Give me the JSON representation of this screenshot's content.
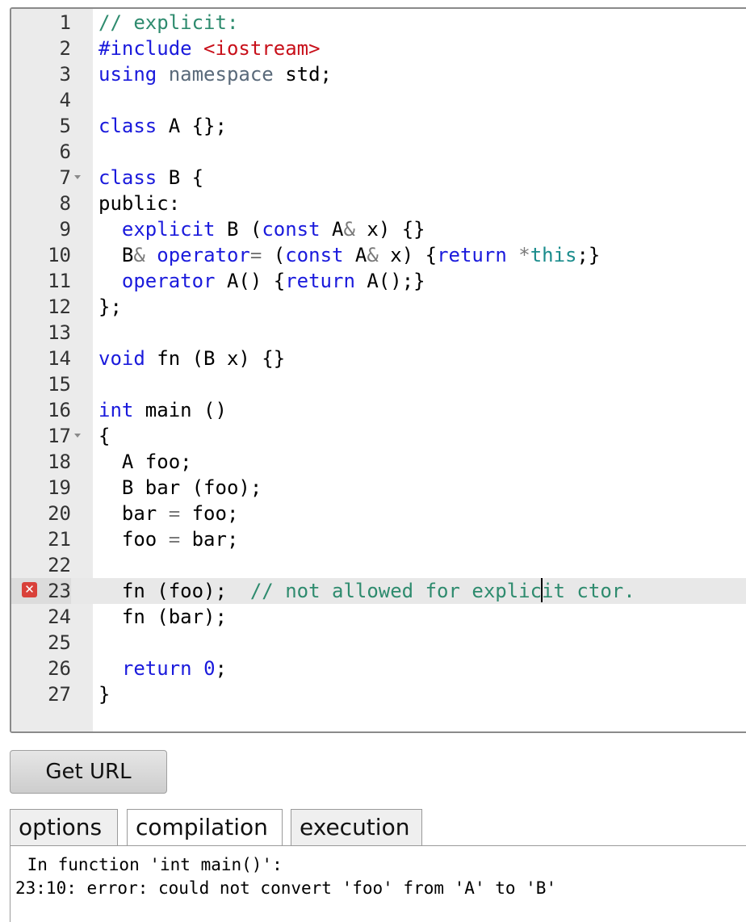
{
  "editor": {
    "lines": [
      {
        "n": "1",
        "tokens": [
          [
            "cm",
            "// explicit:"
          ]
        ]
      },
      {
        "n": "2",
        "tokens": [
          [
            "kw",
            "#include "
          ],
          [
            "str",
            "<iostream>"
          ]
        ]
      },
      {
        "n": "3",
        "tokens": [
          [
            "kw",
            "using "
          ],
          [
            "nm",
            "namespace "
          ],
          [
            "",
            "std;"
          ]
        ]
      },
      {
        "n": "4",
        "tokens": []
      },
      {
        "n": "5",
        "tokens": [
          [
            "kw",
            "class "
          ],
          [
            "",
            "A {};"
          ]
        ]
      },
      {
        "n": "6",
        "tokens": []
      },
      {
        "n": "7",
        "fold": true,
        "tokens": [
          [
            "kw",
            "class "
          ],
          [
            "",
            "B {"
          ]
        ]
      },
      {
        "n": "8",
        "tokens": [
          [
            "",
            "public:"
          ]
        ]
      },
      {
        "n": "9",
        "tokens": [
          [
            "",
            "  "
          ],
          [
            "kw",
            "explicit "
          ],
          [
            "",
            "B ("
          ],
          [
            "kw",
            "const "
          ],
          [
            "",
            "A"
          ],
          [
            "op",
            "& "
          ],
          [
            "",
            "x) {}"
          ]
        ]
      },
      {
        "n": "10",
        "tokens": [
          [
            "",
            "  B"
          ],
          [
            "op",
            "& "
          ],
          [
            "kw",
            "operator"
          ],
          [
            "op",
            "= "
          ],
          [
            "",
            "("
          ],
          [
            "kw",
            "const "
          ],
          [
            "",
            "A"
          ],
          [
            "op",
            "& "
          ],
          [
            "",
            "x) {"
          ],
          [
            "kw",
            "return "
          ],
          [
            "op",
            "*"
          ],
          [
            "tl",
            "this"
          ],
          [
            "",
            ";}"
          ]
        ]
      },
      {
        "n": "11",
        "tokens": [
          [
            "",
            "  "
          ],
          [
            "kw",
            "operator "
          ],
          [
            "",
            "A() {"
          ],
          [
            "kw",
            "return "
          ],
          [
            "",
            "A();}"
          ]
        ]
      },
      {
        "n": "12",
        "tokens": [
          [
            "",
            "};"
          ]
        ]
      },
      {
        "n": "13",
        "tokens": []
      },
      {
        "n": "14",
        "tokens": [
          [
            "kw",
            "void "
          ],
          [
            "",
            "fn (B x) {}"
          ]
        ]
      },
      {
        "n": "15",
        "tokens": []
      },
      {
        "n": "16",
        "tokens": [
          [
            "kw",
            "int "
          ],
          [
            "",
            "main ()"
          ]
        ]
      },
      {
        "n": "17",
        "fold": true,
        "tokens": [
          [
            "",
            "{"
          ]
        ]
      },
      {
        "n": "18",
        "tokens": [
          [
            "",
            "  A foo;"
          ]
        ]
      },
      {
        "n": "19",
        "tokens": [
          [
            "",
            "  B bar (foo);"
          ]
        ]
      },
      {
        "n": "20",
        "tokens": [
          [
            "",
            "  bar "
          ],
          [
            "op",
            "= "
          ],
          [
            "",
            "foo;"
          ]
        ]
      },
      {
        "n": "21",
        "tokens": [
          [
            "",
            "  foo "
          ],
          [
            "op",
            "= "
          ],
          [
            "",
            "bar;"
          ]
        ]
      },
      {
        "n": "22",
        "tokens": []
      },
      {
        "n": "23",
        "error": true,
        "active": true,
        "tokens": [
          [
            "",
            "  fn (foo);  "
          ],
          [
            "cm",
            "// not allowed for explic"
          ],
          [
            "cursor",
            ""
          ],
          [
            "cm",
            "it ctor."
          ]
        ]
      },
      {
        "n": "24",
        "tokens": [
          [
            "",
            "  fn (bar);"
          ]
        ]
      },
      {
        "n": "25",
        "tokens": []
      },
      {
        "n": "26",
        "tokens": [
          [
            "",
            "  "
          ],
          [
            "kw",
            "return "
          ],
          [
            "num",
            "0"
          ],
          [
            "",
            ";"
          ]
        ]
      },
      {
        "n": "27",
        "tokens": [
          [
            "",
            "}"
          ]
        ]
      }
    ]
  },
  "buttons": {
    "get_url": "Get URL"
  },
  "tabs": [
    {
      "label": "options"
    },
    {
      "label": "compilation",
      "active": true
    },
    {
      "label": "execution"
    }
  ],
  "output": {
    "lines": [
      " In function 'int main()':",
      "23:10: error: could not convert 'foo' from 'A' to 'B'"
    ]
  },
  "colors": {
    "keyword": "#1a1adc",
    "string": "#c8101a",
    "comment": "#2e8b6e",
    "error_marker": "#d9413a",
    "gutter": "#ebebeb"
  },
  "icons": {
    "error_marker": "error-x-icon",
    "fold": "fold-arrow-icon"
  }
}
